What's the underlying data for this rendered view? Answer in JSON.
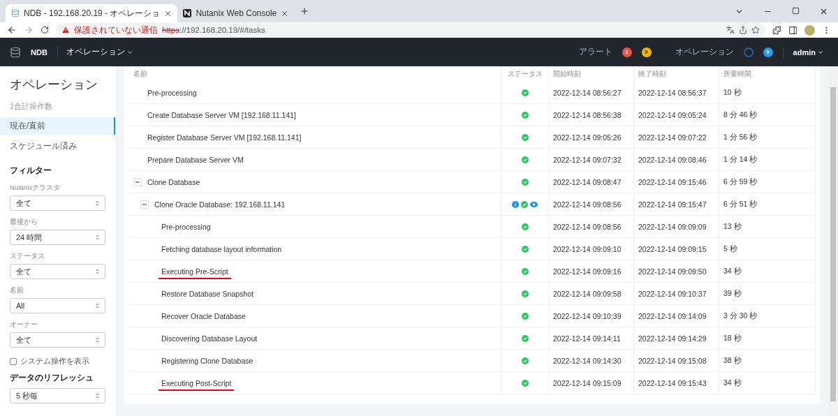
{
  "browser": {
    "tabs": [
      {
        "title": "NDB - 192.168.20.19 - オペレーショ",
        "selected": true
      },
      {
        "title": "Nutanix Web Console",
        "selected": false
      }
    ],
    "address": {
      "warning": "保護されていない通信",
      "scheme": "https",
      "rest": "://192.168.20.19/#/tasks"
    }
  },
  "navbar": {
    "brand": "NDB",
    "menu": "オペレーション",
    "alerts_label": "アラート",
    "alert_counts": [
      {
        "count": "1",
        "color": "#e9524a"
      },
      {
        "count": "0",
        "color": "#f5b400"
      }
    ],
    "operations_label": "オペレーション",
    "operations_count": "0",
    "user": "admin"
  },
  "sidebar": {
    "title": "オペレーション",
    "summary": "1合計操作数",
    "items": [
      {
        "label": "現在/直前",
        "selected": true
      },
      {
        "label": "スケジュール済み",
        "selected": false
      }
    ],
    "filters_heading": "フィルター",
    "filters": [
      {
        "label": "Nutanixクラスタ",
        "value": "全て"
      },
      {
        "label": "最後から",
        "value": "24 時間"
      },
      {
        "label": "ステータス",
        "value": "全て"
      },
      {
        "label": "名前",
        "value": "All"
      },
      {
        "label": "オーナー",
        "value": "全て"
      }
    ],
    "system_ops": {
      "label": "システム操作を表示",
      "checked": false
    },
    "refresh_heading": "データのリフレッシュ",
    "refresh": {
      "value": "5 秒毎"
    }
  },
  "table": {
    "columns": [
      "名前",
      "ステータス",
      "開始時刻",
      "終了時刻",
      "所要時間"
    ],
    "rows": [
      {
        "name": "Pre-processing",
        "status": [
          {
            "kind": "success"
          }
        ],
        "start": "2022-12-14 08:56:27",
        "end": "2022-12-14 08:56:37",
        "duration": "10 秒",
        "underlined": false
      },
      {
        "name": "Create Database Server VM [192.168.11.141]",
        "status": [
          {
            "kind": "success"
          }
        ],
        "start": "2022-12-14 08:56:38",
        "end": "2022-12-14 09:05:24",
        "duration": "8 分 46 秒",
        "underlined": false
      },
      {
        "name": "Register Database Server VM [192.168.11.141]",
        "status": [
          {
            "kind": "success"
          }
        ],
        "start": "2022-12-14 09:05:26",
        "end": "2022-12-14 09:07:22",
        "duration": "1 分 56 秒",
        "underlined": false
      },
      {
        "name": "Prepare Database Server VM",
        "status": [
          {
            "kind": "success"
          }
        ],
        "start": "2022-12-14 09:07:32",
        "end": "2022-12-14 09:08:46",
        "duration": "1 分 14 秒",
        "underlined": false
      },
      {
        "name": "Clone Database",
        "status": [
          {
            "kind": "success"
          }
        ],
        "start": "2022-12-14 09:08:47",
        "end": "2022-12-14 09:15:46",
        "duration": "6 分 59 秒",
        "underlined": false,
        "expanded": true,
        "children": [
          {
            "name": "Clone Oracle Database: 192.168.11.141",
            "status": [
              {
                "kind": "info"
              },
              {
                "kind": "success"
              },
              {
                "kind": "view"
              }
            ],
            "start": "2022-12-14 09:08:56",
            "end": "2022-12-14 09:15:47",
            "duration": "6 分 51 秒",
            "underlined": false,
            "expanded": true,
            "children": [
              {
                "name": "Pre-processing",
                "status": [
                  {
                    "kind": "success"
                  }
                ],
                "start": "2022-12-14 09:08:56",
                "end": "2022-12-14 09:09:09",
                "duration": "13 秒",
                "underlined": false
              },
              {
                "name": "Fetching database layout information",
                "status": [
                  {
                    "kind": "success"
                  }
                ],
                "start": "2022-12-14 09:09:10",
                "end": "2022-12-14 09:09:15",
                "duration": "5 秒",
                "underlined": false
              },
              {
                "name": "Executing Pre-Script",
                "status": [
                  {
                    "kind": "success"
                  }
                ],
                "start": "2022-12-14 09:09:16",
                "end": "2022-12-14 09:09:50",
                "duration": "34 秒",
                "underlined": true
              },
              {
                "name": "Restore Database Snapshot",
                "status": [
                  {
                    "kind": "success"
                  }
                ],
                "start": "2022-12-14 09:09:58",
                "end": "2022-12-14 09:10:37",
                "duration": "39 秒",
                "underlined": false
              },
              {
                "name": "Recover Oracle Database",
                "status": [
                  {
                    "kind": "success"
                  }
                ],
                "start": "2022-12-14 09:10:39",
                "end": "2022-12-14 09:14:09",
                "duration": "3 分 30 秒",
                "underlined": false
              },
              {
                "name": "Discovering Database Layout",
                "status": [
                  {
                    "kind": "success"
                  }
                ],
                "start": "2022-12-14 09:14:11",
                "end": "2022-12-14 09:14:29",
                "duration": "18 秒",
                "underlined": false
              },
              {
                "name": "Registering Clone Database",
                "status": [
                  {
                    "kind": "success"
                  }
                ],
                "start": "2022-12-14 09:14:30",
                "end": "2022-12-14 09:15:08",
                "duration": "38 秒",
                "underlined": false
              },
              {
                "name": "Executing Post-Script",
                "status": [
                  {
                    "kind": "success"
                  }
                ],
                "start": "2022-12-14 09:15:09",
                "end": "2022-12-14 09:15:43",
                "duration": "34 秒",
                "underlined": true
              }
            ]
          }
        ]
      }
    ]
  }
}
